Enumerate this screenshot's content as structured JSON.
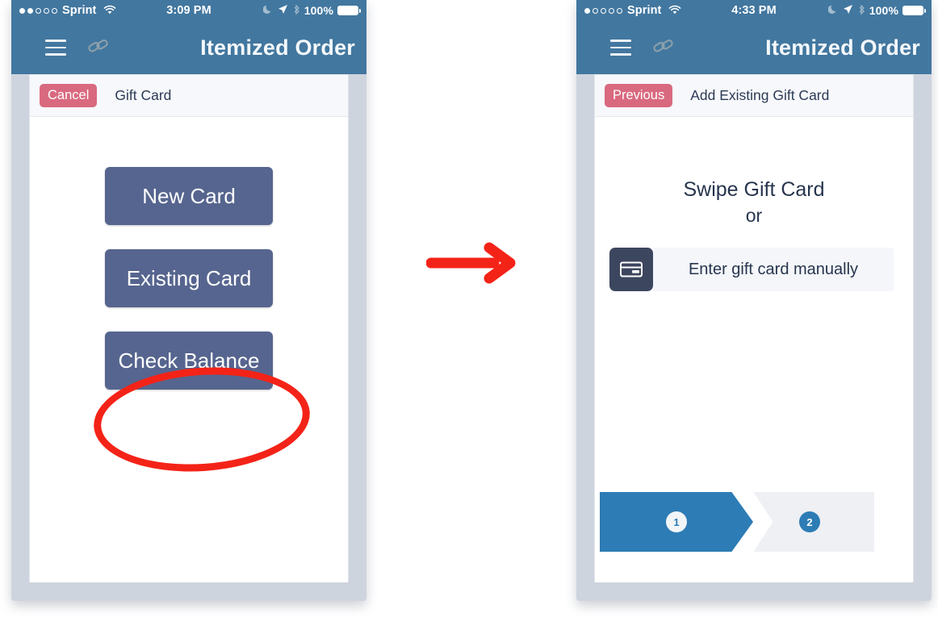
{
  "phones": [
    {
      "id": "left",
      "status_bar": {
        "carrier": "Sprint",
        "signal_dots_filled": 2,
        "signal_dots_total": 5,
        "wifi_icon": "wifi-icon",
        "time": "3:09 PM",
        "moon_icon": "moon-icon",
        "location_icon": "location-arrow-icon",
        "bluetooth_icon": "bluetooth-icon",
        "battery_percent": "100%"
      },
      "app_bar": {
        "menu_icon": "hamburger-menu-icon",
        "link_icon": "link-chain-icon",
        "title": "Itemized Order"
      },
      "modal": {
        "back_label": "Cancel",
        "title": "Gift Card",
        "buttons": [
          {
            "label": "New Card"
          },
          {
            "label": "Existing Card"
          },
          {
            "label": "Check Balance"
          }
        ]
      }
    },
    {
      "id": "right",
      "status_bar": {
        "carrier": "Sprint",
        "signal_dots_filled": 1,
        "signal_dots_total": 5,
        "wifi_icon": "wifi-icon",
        "time": "4:33 PM",
        "moon_icon": "moon-icon",
        "location_icon": "location-arrow-icon",
        "bluetooth_icon": "bluetooth-icon",
        "battery_percent": "100%"
      },
      "app_bar": {
        "menu_icon": "hamburger-menu-icon",
        "link_icon": "link-chain-icon",
        "title": "Itemized Order"
      },
      "modal": {
        "back_label": "Previous",
        "title": "Add Existing Gift Card",
        "swipe_title": "Swipe Gift Card",
        "or_label": "or",
        "manual_icon": "credit-card-icon",
        "manual_label": "Enter gift card manually",
        "steps": [
          {
            "number": "1",
            "state": "active"
          },
          {
            "number": "2",
            "state": "inactive"
          }
        ]
      }
    }
  ],
  "annotations": {
    "highlight_ellipse": "existing-card-highlight",
    "flow_arrow": "flow-arrow-right"
  },
  "colors": {
    "header_blue": "#42779f",
    "button_slate": "#56658f",
    "pill_pink": "#d9697f",
    "annotation_red": "#f42318",
    "step_active_blue": "#2d7cb5",
    "phone_body": "#ced4de"
  }
}
